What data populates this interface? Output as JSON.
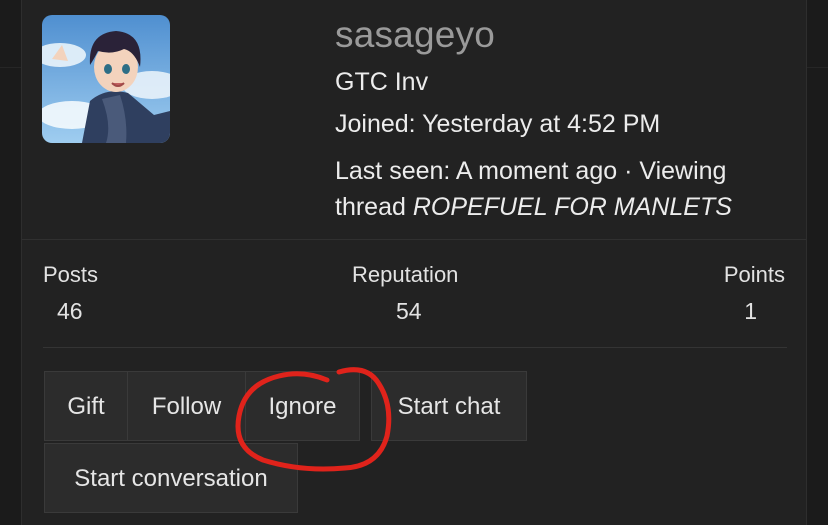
{
  "profile": {
    "username": "sasageyo",
    "user_title": "GTC Inv",
    "joined": "Joined: Yesterday at 4:52 PM",
    "last_seen_prefix": "Last seen: A moment ago · Viewing thread ",
    "last_seen_thread": "ROPEFUEL FOR MANLETS"
  },
  "stats": [
    {
      "label": "Posts",
      "value": "46"
    },
    {
      "label": "Reputation",
      "value": "54"
    },
    {
      "label": "Points",
      "value": "1"
    }
  ],
  "actions": {
    "gift": "Gift",
    "follow": "Follow",
    "ignore": "Ignore",
    "start_chat": "Start chat",
    "start_conversation": "Start conversation"
  },
  "colors": {
    "background": "#1b1b1b",
    "card": "#222222",
    "button": "#2c2c2c",
    "annotation": "#e0231b"
  }
}
